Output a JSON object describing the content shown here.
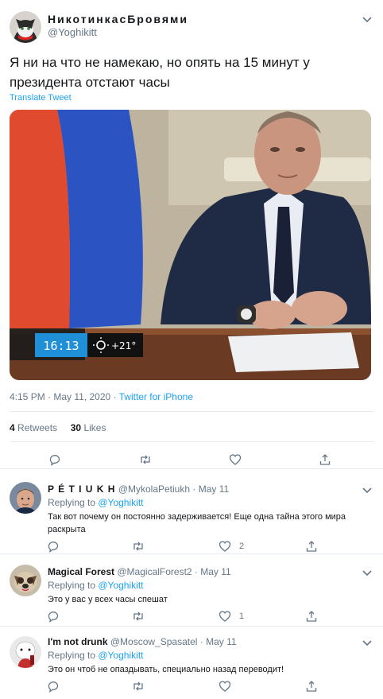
{
  "tweet": {
    "author_name": "НикотинкасБровями",
    "author_handle": "@Yoghikitt",
    "text": "Я ни на что не намекаю, но опять на 15 минут у президента отстают часы",
    "translate_label": "Translate Tweet",
    "media": {
      "clock_text": "16:13",
      "weather_text": "+21°"
    },
    "timestamp": "4:15 PM · May 11, 2020 · ",
    "source": "Twitter for iPhone",
    "retweets_count": "4",
    "retweets_label": "Retweets",
    "likes_count": "30",
    "likes_label": "Likes"
  },
  "replies": [
    {
      "name": "P É T I U K H",
      "handle": "@MykolaPetiukh",
      "date": "May 11",
      "replying_prefix": "Replying to ",
      "replying_to": "@Yoghikitt",
      "text": "Так вот почему он постоянно задерживается! Еще одна тайна этого мира раскрыта",
      "likes": "2"
    },
    {
      "name": "Magical Forest",
      "handle": "@MagicalForest2",
      "date": "May 11",
      "replying_prefix": "Replying to ",
      "replying_to": "@Yoghikitt",
      "text": "Это у вас у всех часы спешат",
      "likes": "1"
    },
    {
      "name": "I'm not drunk",
      "handle": "@Moscow_Spasatel",
      "date": "May 11",
      "replying_prefix": "Replying to ",
      "replying_to": "@Yoghikitt",
      "text": "Это он чтоб не опаздывать, специально назад переводит!",
      "likes": ""
    }
  ],
  "colors": {
    "accent": "#1da1f2",
    "secondary_text": "#657786",
    "divider": "#e6ecf0"
  },
  "icons": [
    "reply-icon",
    "retweet-icon",
    "like-icon",
    "share-icon",
    "chevron-down-icon"
  ]
}
